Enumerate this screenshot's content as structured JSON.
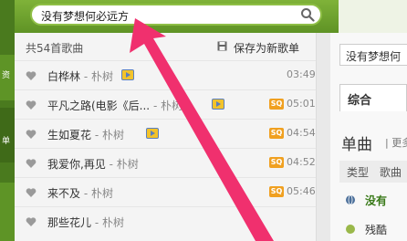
{
  "sidebar": {
    "items": [
      {
        "label": "资"
      },
      {
        "label": "单"
      }
    ]
  },
  "search": {
    "value": "没有梦想何必远方",
    "icon": "search-icon"
  },
  "panel": {
    "count": "共54首歌曲",
    "save_label": "保存为新歌单"
  },
  "songs": [
    {
      "title": "白桦林",
      "artist": " - 朴树",
      "mv": true,
      "sq": false,
      "duration": "03:49"
    },
    {
      "title": "平凡之路(电影《后...",
      "artist": " - 朴树",
      "mv": true,
      "sq": true,
      "duration": "05:01"
    },
    {
      "title": "生如夏花",
      "artist": " - 朴树",
      "mv": true,
      "sq": true,
      "duration": "04:54"
    },
    {
      "title": "我爱你,再见",
      "artist": " - 朴树",
      "mv": false,
      "sq": true,
      "duration": "04:52"
    },
    {
      "title": "来不及",
      "artist": " - 朴树",
      "mv": false,
      "sq": true,
      "duration": "05:46"
    },
    {
      "title": "那些花儿",
      "artist": " - 朴树",
      "mv": false,
      "sq": false,
      "duration": ""
    }
  ],
  "sq_label": "SQ",
  "right": {
    "search_value": "没有梦想何",
    "tab": "综合",
    "section": "单曲",
    "more": "| 更多",
    "col_type": "类型",
    "col_song": "歌曲",
    "row1": "没有",
    "row2": "残酷"
  },
  "colors": {
    "accent_green": "#6aa22e",
    "arrow_pink": "#f0306e",
    "sq_orange": "#f0a020"
  }
}
